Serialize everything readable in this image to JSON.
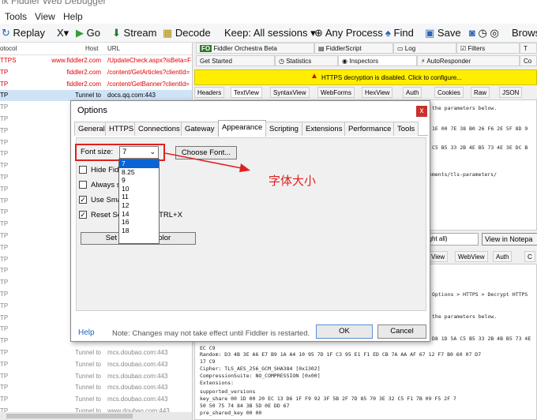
{
  "window_title": "lk Fiddler Web Debugger",
  "menu": [
    "Tools",
    "View",
    "Help"
  ],
  "toolbar": {
    "replay": "Replay",
    "x": "X",
    "go": "Go",
    "stream": "Stream",
    "decode": "Decode",
    "keep": "Keep: All sessions",
    "process": "Any Process",
    "find": "Find",
    "save": "Save",
    "browse": "Brows"
  },
  "sessions": {
    "headers": {
      "protocol": "otocol",
      "host": "Host",
      "url": "URL"
    },
    "rows": [
      {
        "p": "TTPS",
        "h": "www.fiddler2.com",
        "u": "/UpdateCheck.aspx?isBeta=F",
        "c": "red"
      },
      {
        "p": "TP",
        "h": "fiddler2.com",
        "u": "/content/GetArticles?clientId=",
        "c": "red"
      },
      {
        "p": "TP",
        "h": "fiddler2.com",
        "u": "/content/GetBanner?clientId=",
        "c": "red"
      },
      {
        "p": "TP",
        "h": "Tunnel to",
        "u": "docs.qq.com:443",
        "c": "sel"
      },
      {
        "p": "TP",
        "h": "",
        "u": "",
        "c": "gray"
      },
      {
        "p": "TP",
        "h": "",
        "u": "",
        "c": "gray"
      },
      {
        "p": "TP",
        "h": "",
        "u": "",
        "c": "gray"
      },
      {
        "p": "TP",
        "h": "",
        "u": "",
        "c": "gray"
      },
      {
        "p": "TP",
        "h": "",
        "u": "",
        "c": "gray"
      },
      {
        "p": "TP",
        "h": "",
        "u": "",
        "c": "gray"
      },
      {
        "p": "TP",
        "h": "",
        "u": "",
        "c": "gray"
      },
      {
        "p": "TP",
        "h": "",
        "u": "",
        "c": "gray"
      },
      {
        "p": "TP",
        "h": "",
        "u": "",
        "c": "gray"
      },
      {
        "p": "TP",
        "h": "",
        "u": "",
        "c": "gray"
      },
      {
        "p": "TP",
        "h": "",
        "u": "",
        "c": "gray"
      },
      {
        "p": "TP",
        "h": "",
        "u": "",
        "c": "gray"
      },
      {
        "p": "TP",
        "h": "",
        "u": "",
        "c": "gray"
      },
      {
        "p": "TP",
        "h": "",
        "u": "",
        "c": "gray"
      },
      {
        "p": "TP",
        "h": "",
        "u": "",
        "c": "gray"
      },
      {
        "p": "TP",
        "h": "",
        "u": "",
        "c": "gray"
      },
      {
        "p": "TP",
        "h": "",
        "u": "",
        "c": "gray"
      },
      {
        "p": "TP",
        "h": "",
        "u": "",
        "c": "gray"
      },
      {
        "p": "TP",
        "h": "",
        "u": "",
        "c": "gray"
      },
      {
        "p": "TP",
        "h": "",
        "u": "",
        "c": "gray"
      },
      {
        "p": "TP",
        "h": "",
        "u": "",
        "c": "gray"
      },
      {
        "p": "TP",
        "h": "Tunnel to",
        "u": "mcs.doubao.com:443",
        "c": "gray"
      },
      {
        "p": "TP",
        "h": "Tunnel to",
        "u": "mcs.doubao.com:443",
        "c": "gray"
      },
      {
        "p": "TP",
        "h": "Tunnel to",
        "u": "mcs.doubao.com:443",
        "c": "gray"
      },
      {
        "p": "TP",
        "h": "Tunnel to",
        "u": "mcs.doubao.com:443",
        "c": "gray"
      },
      {
        "p": "TP",
        "h": "Tunnel to",
        "u": "mcs.doubao.com:443",
        "c": "gray"
      },
      {
        "p": "TP",
        "h": "Tunnel to",
        "u": "www.doubao.com:443",
        "c": "gray"
      }
    ]
  },
  "right": {
    "top_tabs": [
      "Fiddler Orchestra Beta",
      "FiddlerScript",
      "Log",
      "Filters",
      "T"
    ],
    "top_tabs2": [
      "Get Started",
      "Statistics",
      "Inspectors",
      "AutoResponder",
      "Co"
    ],
    "warning": "HTTPS decryption is disabled. Click to configure...",
    "sub_tabs": [
      "Headers",
      "TextView",
      "SyntaxView",
      "WebForms",
      "HexView",
      "Auth",
      "Cookies",
      "Raw",
      "JSON"
    ],
    "text_lines": [
      "the parameters below.",
      "1E 00 7E 38 B0 26 F6 2E 5F 8D 9",
      "C5 B5 33 2B 4E B5 73 4E 3E DC B",
      "gnments/tls-parameters/"
    ],
    "find_value": "light all)",
    "view_notepad": "View in Notepa",
    "sub_tabs2": [
      "View",
      "WebView",
      "Auth",
      "C"
    ],
    "text2_lines": [
      "Options > HTTPS > Decrypt HTTPS",
      "the parameters below.",
      "D8 1D 5A C5 B5 33 2B 4B B5 73 4E",
      "EC C9",
      "Random:          D3 4B 3E A6 E7 B9 1A A4 10 95 7D 1F C3 95 E1 F1 ED CB 7A AA AF 67 12 F7 B0 60 07 D7",
      "17 C9",
      "Cipher:          TLS_AES_256_GCM_SHA384 [0x1302]",
      "CompressionSuite: NO_COMPRESSION [0x00]",
      "Extensions:",
      "                 supported_versions",
      "                 key_share 00 1D 00 20 EC 13 D6 1F F9 92 3F 5B 2F 7D 85 70 3E 32 C5 F1 7B 09 F5 2F 7",
      "50 50 75 74 84 3B 5D 0E DD 67",
      "                 pre_shared_key      00 00"
    ]
  },
  "dialog": {
    "title": "Options",
    "close": "x",
    "tabs": [
      "General",
      "HTTPS",
      "Connections",
      "Gateway",
      "Appearance",
      "Scripting",
      "Extensions",
      "Performance",
      "Tools"
    ],
    "active_tab": "Appearance",
    "font_size_label": "Font size:",
    "font_size_value": "7",
    "choose_font": "Choose Font...",
    "checkboxes": [
      {
        "label": "Hide Fid         inimized",
        "checked": false
      },
      {
        "label": "Always s         on",
        "checked": false
      },
      {
        "label": "Use Sma       ession List",
        "checked": true
      },
      {
        "label": "Reset Se       unter on CTRL+X",
        "checked": true
      }
    ],
    "set_color": "Set Readonly Color",
    "dropdown_options": [
      "7",
      "8.25",
      "9",
      "10",
      "11",
      "12",
      "14",
      "16",
      "18"
    ],
    "help": "Help",
    "note": "Note: Changes may not take effect until Fiddler is restarted.",
    "ok": "OK",
    "cancel": "Cancel"
  },
  "annotation": "字体大小",
  "colors": {
    "accent_red": "#e02020",
    "warning_bg": "#ffee00",
    "selection": "#0a64d6"
  }
}
